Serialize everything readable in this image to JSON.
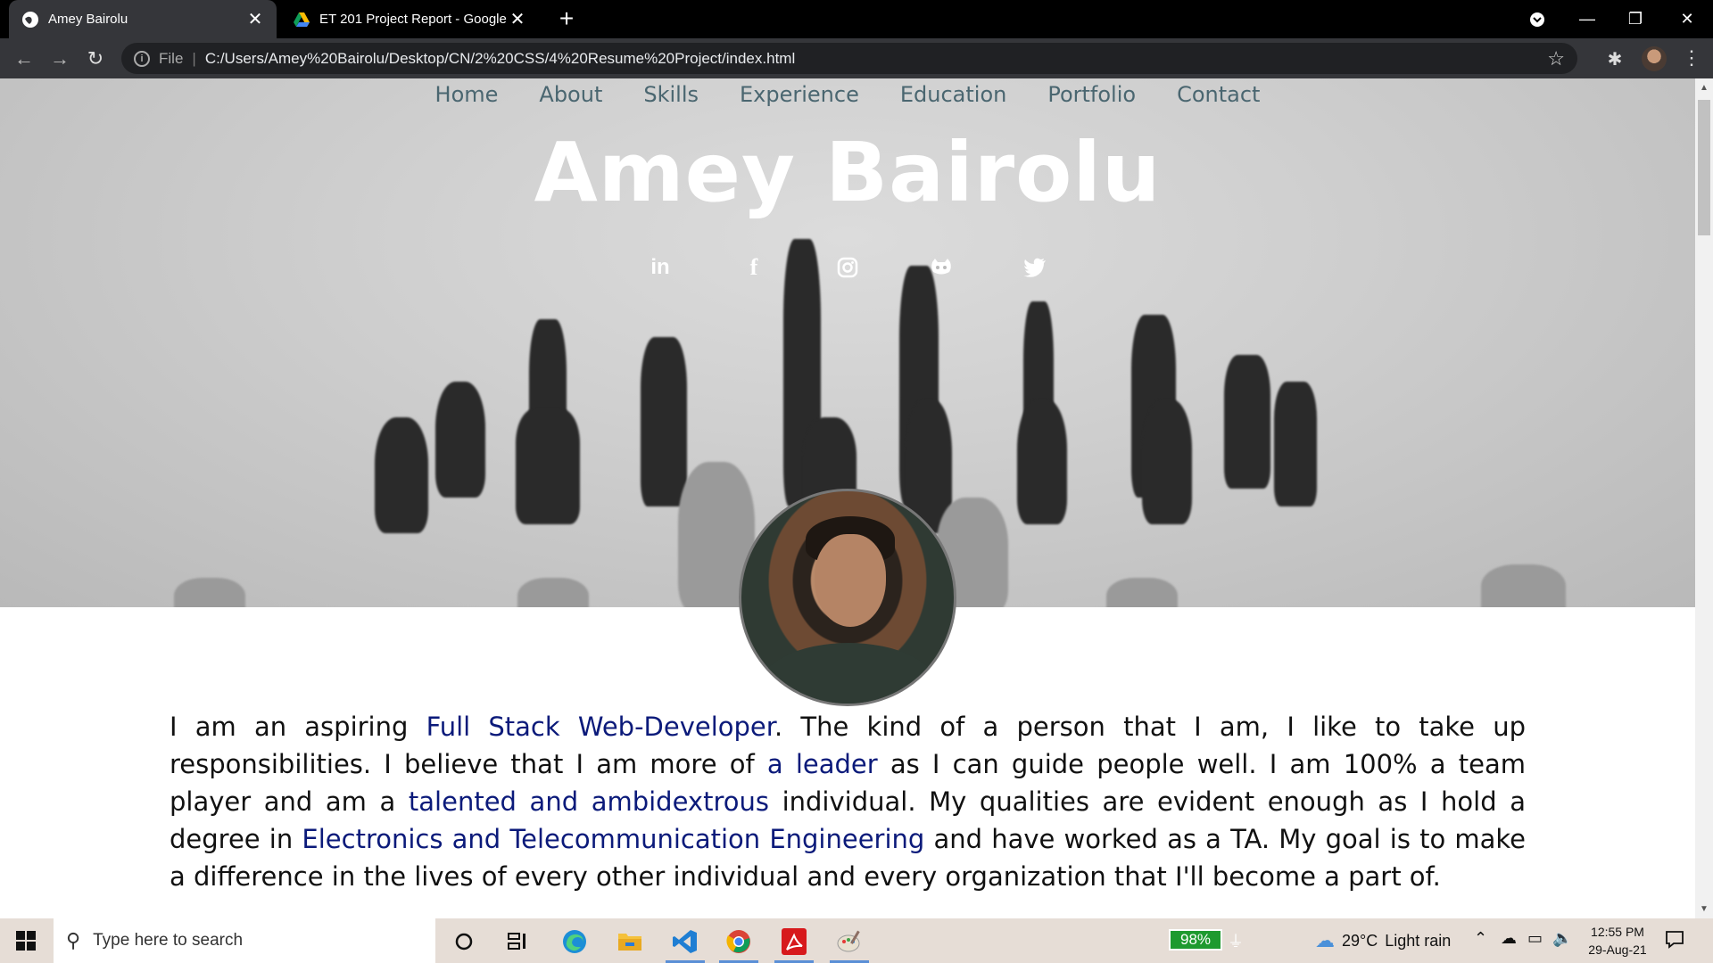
{
  "browser": {
    "tabs": [
      {
        "title": "Amey Bairolu",
        "active": true,
        "favicon": "globe-icon"
      },
      {
        "title": "ET 201 Project Report - Google D",
        "active": false,
        "favicon": "google-drive-icon"
      }
    ],
    "omnibox": {
      "file_label": "File",
      "url": "C:/Users/Amey%20Bairolu/Desktop/CN/2%20CSS/4%20Resume%20Project/index.html"
    }
  },
  "page": {
    "nav": [
      "Home",
      "About",
      "Skills",
      "Experience",
      "Education",
      "Portfolio",
      "Contact"
    ],
    "hero_name": "Amey Bairolu",
    "socials": [
      "linkedin-icon",
      "facebook-icon",
      "instagram-icon",
      "github-icon",
      "twitter-icon"
    ],
    "bio": {
      "p1": "I am an aspiring ",
      "h1": "Full Stack Web-Developer",
      "p2": ". The kind of a person that I am, I like to take up responsibilities. I believe that I am more of ",
      "h2": "a leader",
      "p3": " as I can guide people well. I am 100% a team player and am a ",
      "h3": "talented and ambidextrous",
      "p4": " individual. My qualities are evident enough as I hold a degree in ",
      "h4": "Electronics and Telecommunication Engineering",
      "p5": " and have worked as a TA. My goal is to make a difference in the lives of every other individual and every organization that I'll become a part of."
    }
  },
  "taskbar": {
    "search_placeholder": "Type here to search",
    "battery": "98%",
    "weather": {
      "temp": "29°C",
      "desc": "Light rain"
    },
    "clock": {
      "time": "12:55 PM",
      "date": "29-Aug-21"
    }
  },
  "colors": {
    "highlight": "#0b1a7a",
    "nav_text": "#4a6670",
    "battery_green": "#1e9a2f"
  }
}
